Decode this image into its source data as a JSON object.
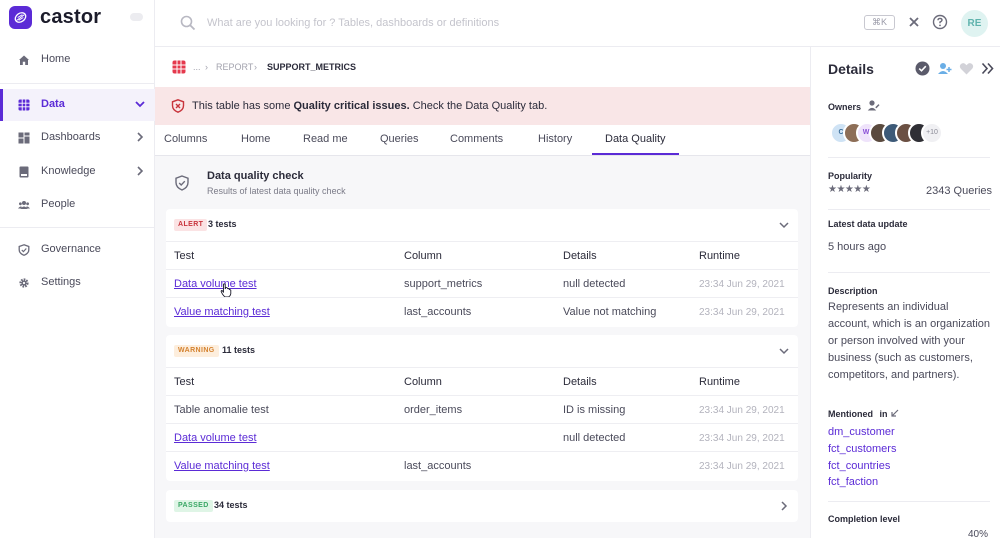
{
  "app": {
    "name": "castor"
  },
  "sidebar": {
    "items": [
      {
        "label": "Home",
        "icon": "home-icon"
      },
      {
        "label": "Data",
        "icon": "table-icon",
        "active": true
      },
      {
        "label": "Dashboards",
        "icon": "dashboard-icon"
      },
      {
        "label": "Knowledge",
        "icon": "book-icon"
      },
      {
        "label": "People",
        "icon": "people-icon"
      },
      {
        "label": "Governance",
        "icon": "shield-icon"
      },
      {
        "label": "Settings",
        "icon": "gear-icon"
      }
    ]
  },
  "topbar": {
    "search_placeholder": "What are you looking for ? Tables, dashboards or definitions",
    "shortcut": "⌘K",
    "user_initials": "RE"
  },
  "breadcrumb": {
    "ellipsis": "...",
    "parent": "REPORT",
    "current": "SUPPORT_METRICS"
  },
  "banner": {
    "prefix": "This table has some",
    "bold": "Quality critical issues.",
    "suffix": "Check the Data Quality tab."
  },
  "tabs": [
    "Columns",
    "Home",
    "Read me",
    "Queries",
    "Comments",
    "History",
    "Data Quality"
  ],
  "active_tab": "Data Quality",
  "data_quality": {
    "title": "Data quality check",
    "subtitle": "Results of latest data quality check",
    "columns": [
      "Test",
      "Column",
      "Details",
      "Runtime"
    ],
    "groups": [
      {
        "status": "ALERT",
        "count": "3 tests",
        "rows": [
          {
            "test": "Data volume test",
            "column": "support_metrics",
            "details": "null detected",
            "runtime": "23:34 Jun 29, 2021"
          },
          {
            "test": "Value matching test",
            "column": "last_accounts",
            "details": "Value not matching",
            "runtime": "23:34 Jun 29, 2021"
          }
        ]
      },
      {
        "status": "WARNING",
        "count": "11 tests",
        "rows": [
          {
            "test": "Table anomalie test",
            "column": "order_items",
            "details": "ID is missing",
            "runtime": "23:34 Jun 29, 2021"
          },
          {
            "test": "Data volume test",
            "column": "",
            "details": "null detected",
            "runtime": "23:34 Jun 29, 2021"
          },
          {
            "test": "Value matching test",
            "column": "last_accounts",
            "details": "",
            "runtime": "23:34 Jun 29, 2021"
          }
        ]
      },
      {
        "status": "PASSED",
        "count": "34 tests"
      }
    ]
  },
  "details": {
    "title": "Details",
    "owners_label": "Owners",
    "owners": [
      {
        "initials": "C",
        "color": "#cfe3f5"
      },
      {
        "initials": "",
        "color": "#8d6e57"
      },
      {
        "initials": "WI",
        "color": "#efe3fb"
      },
      {
        "initials": "",
        "color": "#5a4a3e"
      },
      {
        "initials": "",
        "color": "#3d5a78"
      },
      {
        "initials": "",
        "color": "#6b5043"
      },
      {
        "initials": "",
        "color": "#2f2f35"
      }
    ],
    "owners_more": "+10",
    "popularity_label": "Popularity",
    "popularity_stars": 5,
    "popularity_queries": "2343 Queries",
    "update_label": "Latest data update",
    "update_value": "5 hours ago",
    "description_label": "Description",
    "description": "Represents an individual account, which is an organization or person involved with your business (such as customers, competitors, and partners).",
    "mentioned_label": "Mentioned",
    "mentioned_in": "in",
    "mentioned": [
      "dm_customer",
      "fct_customers",
      "fct_countries",
      "fct_faction"
    ],
    "completion_label": "Completion level",
    "completion_value": "40%",
    "colors": {
      "accent": "#5b2bd6",
      "alert": "#c8343c",
      "warning": "#d4822f",
      "passed": "#3aa765"
    }
  }
}
